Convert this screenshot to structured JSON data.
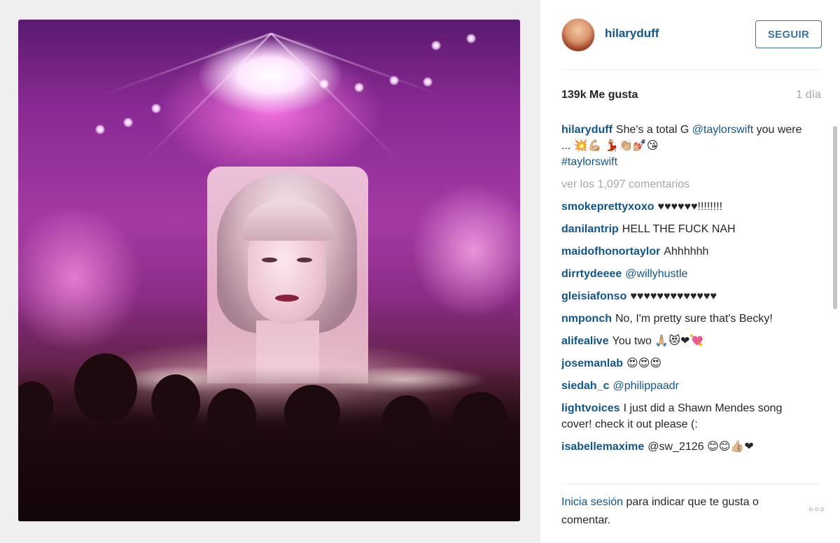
{
  "post": {
    "username": "hilaryduff",
    "follow_label": "SEGUIR",
    "likes": "139k Me gusta",
    "time": "1 día",
    "caption": {
      "user": "hilaryduff",
      "text_before": "She's a total G ",
      "mention": "@taylorswift",
      "text_after": " you were ... 💥💪🏼 💃🏼👏🏼💅🏼😘",
      "hashtag": "#taylorswift"
    },
    "view_comments": "ver los 1,097 comentarios",
    "comments": [
      {
        "user": "smokeprettyxoxo",
        "text": "♥♥♥♥♥♥!!!!!!!!"
      },
      {
        "user": "danilantrip",
        "text": "HELL THE FUCK NAH"
      },
      {
        "user": "maidofhonortaylor",
        "text": "Ahhhhhh"
      },
      {
        "user": "dirrtydeeee",
        "text": "@willyhustle"
      },
      {
        "user": "gleisiafonso",
        "text": "♥♥♥♥♥♥♥♥♥♥♥♥♥"
      },
      {
        "user": "nmponch",
        "text": "No, I'm pretty sure that's Becky!"
      },
      {
        "user": "alifealive",
        "text": "You two 🙏🏼😻❤💘"
      },
      {
        "user": "josemanlab",
        "text": "😍😍😍"
      },
      {
        "user": "siedah_c",
        "text": "@philippaadr"
      },
      {
        "user": "lightvoices",
        "text": "I just did a Shawn Mendes song cover! check it out please (:"
      },
      {
        "user": "isabellemaxime",
        "text": "@sw_2126 😊😊👍🏼❤"
      }
    ],
    "login_link": "Inicia sesión",
    "login_text": " para indicar que te gusta o comentar.",
    "more_options": "◦◦◦"
  },
  "colors": {
    "link": "#125688",
    "follow_border": "#3f729b",
    "muted": "#a5a7aa"
  }
}
